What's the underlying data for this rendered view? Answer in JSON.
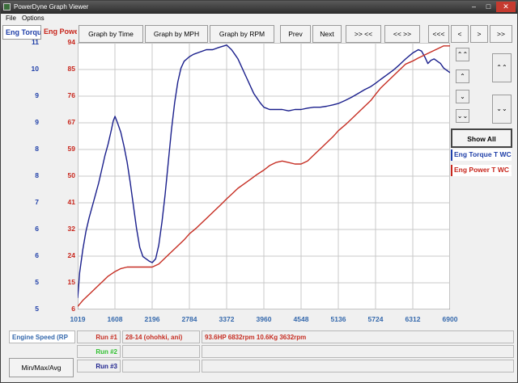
{
  "window": {
    "title": "PowerDyne Graph Viewer"
  },
  "title_buttons": {
    "minimize": "–",
    "maximize": "□",
    "close": "✕"
  },
  "menu": {
    "file": "File",
    "options": "Options"
  },
  "toolbar": {
    "graph_by_time": "Graph by Time",
    "graph_by_mph": "Graph by MPH",
    "graph_by_rpm": "Graph by RPM",
    "prev": "Prev",
    "next": "Next",
    "zoom_in_out": ">> <<",
    "zoom_out": "<< >>",
    "scroll_start": "<<<",
    "scroll_left": "<",
    "scroll_right": ">",
    "scroll_end": ">>"
  },
  "tabs": {
    "torque": "Eng Torque",
    "power": "Eng Power"
  },
  "side": {
    "show_all": "Show All",
    "legend_torque": "Eng Torque T WC",
    "legend_power": "Eng Power T WC i"
  },
  "colors": {
    "torque": "#1a1f8c",
    "power": "#c62e23",
    "torque_label": "#1f3fa8",
    "power_label": "#c8261c",
    "x_label": "#3468ac"
  },
  "bottom": {
    "axis_selector": "Engine Speed (RP",
    "min_max_avg": "Min/Max/Avg",
    "runs": [
      {
        "label": "Run #1",
        "name": "28-14 (ohohki, ani)",
        "summary": "93.6HP  6832rpm  10.6Kg  3632rpm",
        "color": "#c62e23"
      },
      {
        "label": "Run #2",
        "name": "",
        "summary": "",
        "color": "#2fbf2f"
      },
      {
        "label": "Run #3",
        "name": "",
        "summary": "",
        "color": "#1a1f8c"
      }
    ]
  },
  "chart_data": {
    "type": "line",
    "x_ticks": [
      "1019",
      "1608",
      "2196",
      "2784",
      "3372",
      "3960",
      "4548",
      "5136",
      "5724",
      "6312",
      "6900"
    ],
    "y_left_ticks": [
      "11",
      "10",
      "9",
      "9",
      "8",
      "8",
      "7",
      "6",
      "6",
      "5",
      "5"
    ],
    "y_right_ticks": [
      "94",
      "85",
      "76",
      "67",
      "59",
      "50",
      "41",
      "32",
      "24",
      "15",
      "6"
    ],
    "xlim": [
      1019,
      6900
    ],
    "ylim_right": [
      6,
      94
    ],
    "grid": true,
    "series": [
      {
        "name": "Eng Torque T WC",
        "axis": "left",
        "color": "#1a1f8c",
        "x": [
          1019,
          1050,
          1100,
          1150,
          1200,
          1250,
          1300,
          1350,
          1400,
          1450,
          1500,
          1550,
          1580,
          1608,
          1650,
          1700,
          1750,
          1800,
          1850,
          1900,
          1950,
          2000,
          2050,
          2100,
          2150,
          2196,
          2250,
          2300,
          2350,
          2400,
          2450,
          2500,
          2550,
          2600,
          2650,
          2700,
          2784,
          2850,
          2950,
          3050,
          3150,
          3250,
          3372,
          3450,
          3500,
          3550,
          3600,
          3650,
          3700,
          3750,
          3800,
          3850,
          3900,
          3960,
          4050,
          4150,
          4250,
          4350,
          4450,
          4548,
          4650,
          4750,
          4850,
          4950,
          5050,
          5136,
          5250,
          5350,
          5450,
          5550,
          5650,
          5724,
          5800,
          5900,
          6000,
          6100,
          6200,
          6312,
          6400,
          6450,
          6500,
          6550,
          6600,
          6650,
          6700,
          6750,
          6800,
          6850,
          6900
        ],
        "y": [
          5.05,
          5.6,
          6.1,
          6.5,
          6.8,
          7.05,
          7.3,
          7.55,
          7.85,
          8.15,
          8.4,
          8.7,
          8.9,
          9.0,
          8.85,
          8.65,
          8.35,
          8.0,
          7.55,
          7.05,
          6.55,
          6.15,
          5.95,
          5.9,
          5.85,
          5.82,
          5.9,
          6.2,
          6.7,
          7.3,
          8.0,
          8.7,
          9.3,
          9.75,
          10.05,
          10.2,
          10.3,
          10.35,
          10.4,
          10.45,
          10.45,
          10.5,
          10.55,
          10.45,
          10.35,
          10.25,
          10.1,
          9.95,
          9.8,
          9.65,
          9.5,
          9.4,
          9.3,
          9.2,
          9.15,
          9.15,
          9.15,
          9.12,
          9.15,
          9.15,
          9.18,
          9.2,
          9.2,
          9.22,
          9.25,
          9.28,
          9.35,
          9.42,
          9.5,
          9.58,
          9.65,
          9.72,
          9.8,
          9.9,
          10.0,
          10.12,
          10.25,
          10.38,
          10.45,
          10.42,
          10.3,
          10.15,
          10.22,
          10.25,
          10.2,
          10.15,
          10.05,
          10.0,
          9.95
        ]
      },
      {
        "name": "Eng Power T WC",
        "axis": "right",
        "color": "#c62e23",
        "x": [
          1019,
          1100,
          1200,
          1300,
          1400,
          1500,
          1608,
          1700,
          1800,
          1900,
          2000,
          2100,
          2196,
          2300,
          2400,
          2500,
          2600,
          2700,
          2784,
          2900,
          3000,
          3100,
          3200,
          3300,
          3372,
          3450,
          3550,
          3650,
          3750,
          3850,
          3960,
          4050,
          4150,
          4250,
          4350,
          4450,
          4548,
          4650,
          4750,
          4850,
          4950,
          5050,
          5136,
          5250,
          5350,
          5450,
          5550,
          5650,
          5724,
          5800,
          5900,
          6000,
          6100,
          6200,
          6312,
          6400,
          6500,
          6600,
          6700,
          6800,
          6900
        ],
        "y": [
          7,
          9,
          11,
          13,
          15,
          17,
          18.5,
          19.5,
          20,
          20,
          20,
          20,
          20,
          21,
          23,
          25,
          27,
          29,
          31,
          33,
          35,
          37,
          39,
          41,
          42.5,
          44,
          46,
          47.5,
          49,
          50.5,
          52,
          53.5,
          54.5,
          55,
          54.5,
          54,
          54,
          55,
          57,
          59,
          61,
          63,
          65,
          67,
          69,
          71,
          73,
          75,
          77,
          79,
          81,
          83,
          85,
          87,
          88,
          89,
          90,
          91,
          92,
          93,
          93
        ]
      }
    ]
  }
}
